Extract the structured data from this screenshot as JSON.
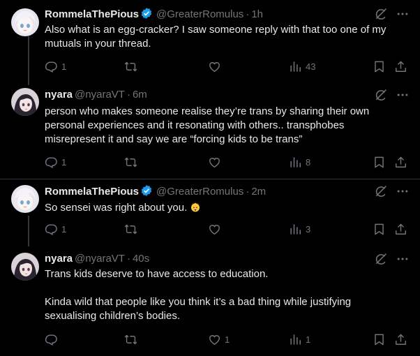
{
  "accent": "#1d9bf0",
  "tweets": [
    {
      "name": "RommelaThePious",
      "verified": true,
      "handle": "@GreaterRomulus",
      "time": "1h",
      "text": "Also what is an egg-cracker? I saw someone reply with that too one of my mutuals in your thread.",
      "replies": "1",
      "retweets": "",
      "likes": "",
      "views": "43",
      "avatar": "white-haired-anime-avatar"
    },
    {
      "name": "nyara",
      "verified": false,
      "handle": "@nyaraVT",
      "time": "6m",
      "text": "person who makes someone realise they’re trans by sharing their own personal experiences and it resonating with others.. transphobes misrepresent it and say we are “forcing kids to be trans”",
      "replies": "1",
      "retweets": "",
      "likes": "",
      "views": "8",
      "avatar": "dark-haired-anime-avatar"
    },
    {
      "name": "RommelaThePious",
      "verified": true,
      "handle": "@GreaterRomulus",
      "time": "2m",
      "text": "So sensei was right about you.",
      "emoji": "exploding-head-emoji",
      "replies": "1",
      "retweets": "",
      "likes": "",
      "views": "3",
      "avatar": "white-haired-anime-avatar"
    },
    {
      "name": "nyara",
      "verified": false,
      "handle": "@nyaraVT",
      "time": "40s",
      "text": "Trans kids deserve to have access to education.\n\nKinda wild that people like you think it’s a bad thing while justifying sexualising children’s bodies.",
      "replies": "",
      "retweets": "",
      "likes": "1",
      "views": "1",
      "avatar": "dark-haired-anime-avatar"
    }
  ]
}
